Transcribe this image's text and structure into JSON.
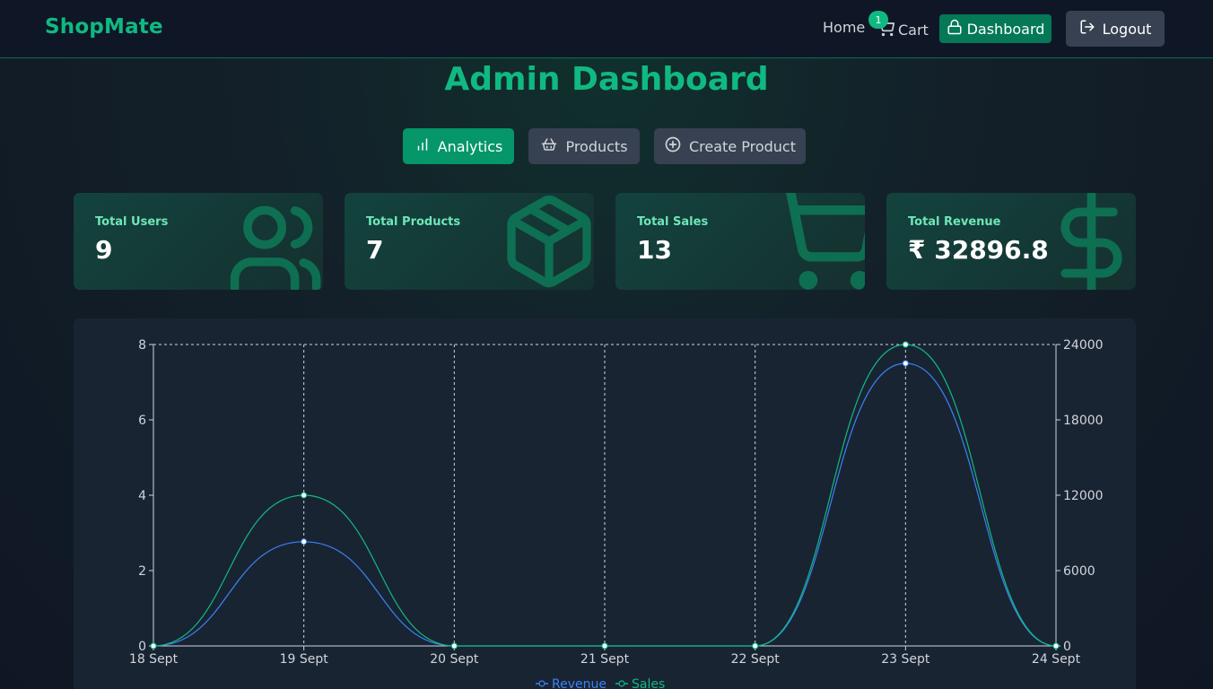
{
  "nav": {
    "brand": "ShopMate",
    "home": "Home",
    "cart": "Cart",
    "cart_count": "1",
    "dashboard": "Dashboard",
    "logout": "Logout"
  },
  "page": {
    "title": "Admin Dashboard"
  },
  "tabs": [
    {
      "label": "Analytics",
      "icon": "bar-chart-icon",
      "active": true
    },
    {
      "label": "Products",
      "icon": "basket-icon",
      "active": false
    },
    {
      "label": "Create Product",
      "icon": "plus-circle-icon",
      "active": false
    }
  ],
  "stats": [
    {
      "label": "Total Users",
      "value": "9",
      "icon": "users-icon"
    },
    {
      "label": "Total Products",
      "value": "7",
      "icon": "package-icon"
    },
    {
      "label": "Total Sales",
      "value": "13",
      "icon": "cart-icon"
    },
    {
      "label": "Total Revenue",
      "value": "₹ 32896.8",
      "icon": "dollar-icon"
    }
  ],
  "colors": {
    "accent": "#10b981",
    "revenue_line": "#3b82f6",
    "sales_line": "#10b981"
  },
  "chart_data": {
    "type": "line",
    "x": [
      "18 Sept",
      "19 Sept",
      "20 Sept",
      "21 Sept",
      "22 Sept",
      "23 Sept",
      "24 Sept"
    ],
    "y_left_ticks": [
      "0",
      "2",
      "4",
      "6",
      "8"
    ],
    "y_left_lim": [
      0,
      8
    ],
    "y_right_ticks": [
      "0",
      "6000",
      "12000",
      "18000",
      "24000"
    ],
    "y_right_lim": [
      0,
      24000
    ],
    "grid": true,
    "legend_position": "bottom",
    "series": [
      {
        "name": "Revenue",
        "axis": "right",
        "color": "#3b82f6",
        "values": [
          0,
          8300,
          0,
          0,
          0,
          22500,
          0
        ]
      },
      {
        "name": "Sales",
        "axis": "left",
        "color": "#10b981",
        "values": [
          0,
          4,
          0,
          0,
          0,
          8,
          0
        ]
      }
    ]
  }
}
